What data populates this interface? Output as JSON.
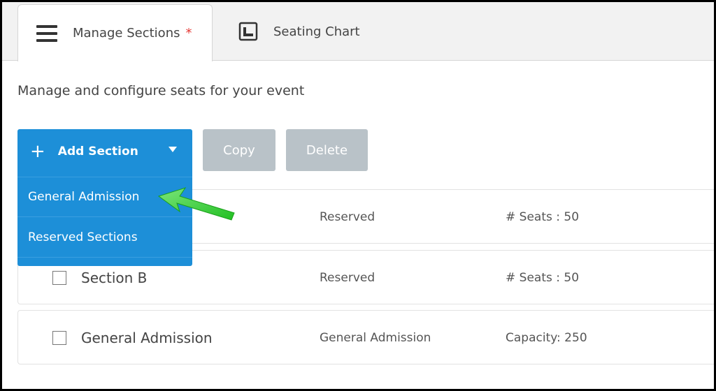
{
  "tabs": [
    {
      "label": "Manage Sections",
      "modified_marker": "*"
    },
    {
      "label": "Seating Chart"
    }
  ],
  "subtitle": "Manage and configure seats for your event",
  "toolbar": {
    "add_label": "Add Section",
    "copy_label": "Copy",
    "delete_label": "Delete"
  },
  "add_menu": {
    "items": [
      "General Admission",
      "Reserved Sections"
    ]
  },
  "sections": [
    {
      "name": "",
      "type": "Reserved",
      "info": "# Seats : 50"
    },
    {
      "name": "Section B",
      "type": "Reserved",
      "info": "# Seats : 50"
    },
    {
      "name": "General Admission",
      "type": "General Admission",
      "info": "Capacity: 250"
    }
  ],
  "colors": {
    "primary": "#1d8fd8",
    "disabled_button": "#b9c2c8",
    "annotation_arrow": "#3ad13a",
    "required_marker": "#e53935"
  },
  "icons": {
    "manage_tab": "hamburger-icon",
    "seating_tab": "seating-chart-icon",
    "add": "plus-icon",
    "dropdown": "caret-down-icon"
  }
}
